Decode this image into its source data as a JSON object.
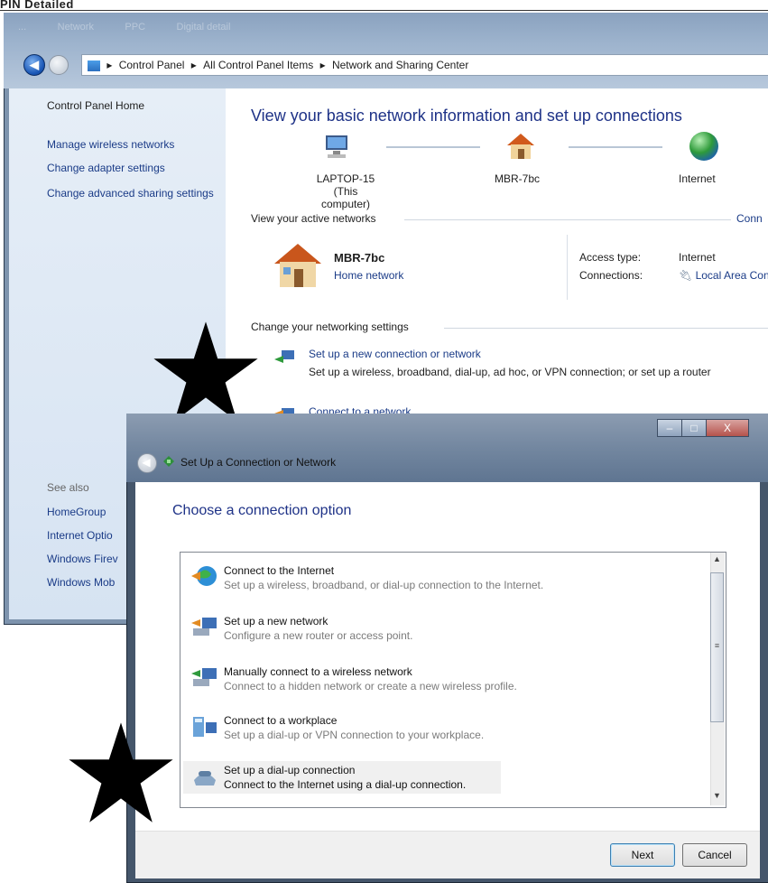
{
  "top_fragment": "PIN Detailed",
  "background_window": {
    "taskbar_items": [
      "...",
      "Network",
      "PPC",
      "Digital detail"
    ],
    "address": {
      "segments": [
        "Control Panel",
        "All Control Panel Items",
        "Network and Sharing Center"
      ],
      "separator": "▸"
    },
    "left_nav": {
      "home": "Control Panel Home",
      "links": [
        "Manage wireless networks",
        "Change adapter settings",
        "Change advanced sharing settings"
      ],
      "see_also_label": "See also",
      "see_also": [
        "HomeGroup",
        "Internet Optio",
        "Windows Firev",
        "Windows Mob"
      ]
    },
    "main": {
      "title": "View your basic network information and set up connections",
      "map": {
        "computer_name": "LAPTOP-15",
        "computer_note": "(This computer)",
        "router_name": "MBR-7bc",
        "internet": "Internet"
      },
      "active_networks_label": "View your active networks",
      "active_networks_link": "Conn",
      "network_name": "MBR-7bc",
      "network_type": "Home network",
      "access_type_label": "Access type:",
      "access_type_value": "Internet",
      "connections_label": "Connections:",
      "connections_value": "Local Area Conn",
      "change_settings_label": "Change your networking settings",
      "tasks": [
        {
          "title": "Set up a new connection or network",
          "desc": "Set up a wireless, broadband, dial-up, ad hoc, or VPN connection; or set up a router"
        },
        {
          "title": "Connect to a network",
          "desc": ""
        }
      ]
    }
  },
  "dialog": {
    "title": "Set Up a Connection or Network",
    "heading": "Choose a connection option",
    "options": [
      {
        "title": "Connect to the Internet",
        "desc": "Set up a wireless, broadband, or dial-up connection to the Internet."
      },
      {
        "title": "Set up a new network",
        "desc": "Configure a new router or access point."
      },
      {
        "title": "Manually connect to a wireless network",
        "desc": "Connect to a hidden network or create a new wireless profile."
      },
      {
        "title": "Connect to a workplace",
        "desc": "Set up a dial-up or VPN connection to your workplace."
      },
      {
        "title": "Set up a dial-up connection",
        "desc": "Connect to the Internet using a dial-up connection."
      }
    ],
    "selected_index": 4,
    "next_label": "Next",
    "cancel_label": "Cancel",
    "controls": {
      "minimize": "–",
      "maximize": "□",
      "close": "X"
    }
  },
  "colors": {
    "heading_blue": "#1e3287",
    "link_blue": "#1a3b87",
    "star": "#000000"
  },
  "icons": [
    "pc-icon",
    "house-icon",
    "globe-icon",
    "star-icon"
  ]
}
